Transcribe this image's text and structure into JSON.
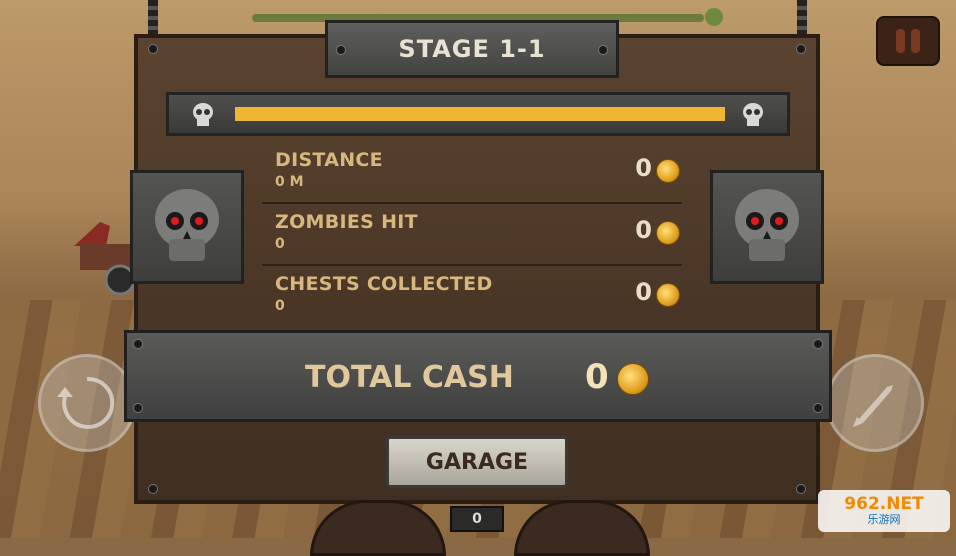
{
  "stage": {
    "title": "STAGE 1-1",
    "progress": 1.0
  },
  "stats": [
    {
      "label": "DISTANCE",
      "value": "0 M",
      "cash": "0"
    },
    {
      "label": "ZOMBIES HIT",
      "value": "0",
      "cash": "0"
    },
    {
      "label": "CHESTS COLLECTED",
      "value": "0",
      "cash": "0"
    }
  ],
  "total": {
    "label": "TOTAL CASH",
    "value": "0"
  },
  "buttons": {
    "garage": "GARAGE"
  },
  "dashboard": {
    "readout": "0"
  },
  "watermark": {
    "brand": "962.NET",
    "site": "乐游网"
  },
  "colors": {
    "progress": "#f0b533",
    "skull_eyes": "#e11b1b",
    "coin": "#e0a020"
  }
}
